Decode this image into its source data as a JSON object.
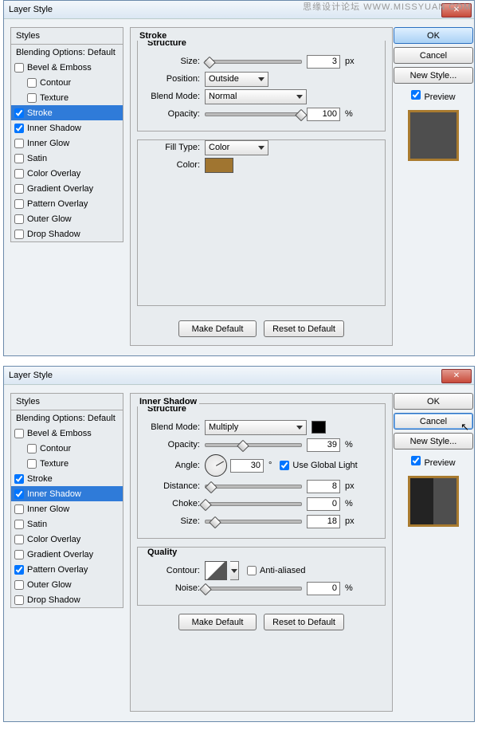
{
  "watermark": "思缘设计论坛 WWW.MISSYUAN.COM",
  "dialogs": [
    {
      "title": "Layer Style",
      "panel_name": "Stroke",
      "selected_row": "Stroke",
      "styles_header": "Styles",
      "blending_row": "Blending Options: Default",
      "styles": {
        "bevel": {
          "label": "Bevel & Emboss",
          "checked": false
        },
        "contour": {
          "label": "Contour",
          "checked": false
        },
        "texture": {
          "label": "Texture",
          "checked": false
        },
        "stroke": {
          "label": "Stroke",
          "checked": true
        },
        "inner_shadow": {
          "label": "Inner Shadow",
          "checked": true
        },
        "inner_glow": {
          "label": "Inner Glow",
          "checked": false
        },
        "satin": {
          "label": "Satin",
          "checked": false
        },
        "color_overlay": {
          "label": "Color Overlay",
          "checked": false
        },
        "gradient_overlay": {
          "label": "Gradient Overlay",
          "checked": false
        },
        "pattern_overlay": {
          "label": "Pattern Overlay",
          "checked": false
        },
        "outer_glow": {
          "label": "Outer Glow",
          "checked": false
        },
        "drop_shadow": {
          "label": "Drop Shadow",
          "checked": false
        }
      },
      "structure_label": "Structure",
      "stroke": {
        "size_label": "Size:",
        "size": "3",
        "size_unit": "px",
        "size_pos": "4%",
        "position_label": "Position:",
        "position": "Outside",
        "blend_label": "Blend Mode:",
        "blend": "Normal",
        "opacity_label": "Opacity:",
        "opacity": "100",
        "opacity_unit": "%",
        "opacity_pos": "100%",
        "filltype_label": "Fill Type:",
        "filltype": "Color",
        "color_label": "Color:",
        "color": "#a07530"
      },
      "defaults": {
        "make": "Make Default",
        "reset": "Reset to Default"
      },
      "buttons": {
        "ok": "OK",
        "cancel": "Cancel",
        "new_style": "New Style..."
      },
      "preview": {
        "label": "Preview",
        "checked": true,
        "border": "#a97b2f",
        "fill": "#4e4e4e"
      }
    },
    {
      "title": "Layer Style",
      "panel_name": "Inner Shadow",
      "selected_row": "Inner Shadow",
      "styles_header": "Styles",
      "blending_row": "Blending Options: Default",
      "styles": {
        "bevel": {
          "label": "Bevel & Emboss",
          "checked": false
        },
        "contour": {
          "label": "Contour",
          "checked": false
        },
        "texture": {
          "label": "Texture",
          "checked": false
        },
        "stroke": {
          "label": "Stroke",
          "checked": true
        },
        "inner_shadow": {
          "label": "Inner Shadow",
          "checked": true
        },
        "inner_glow": {
          "label": "Inner Glow",
          "checked": false
        },
        "satin": {
          "label": "Satin",
          "checked": false
        },
        "color_overlay": {
          "label": "Color Overlay",
          "checked": false
        },
        "gradient_overlay": {
          "label": "Gradient Overlay",
          "checked": false
        },
        "pattern_overlay": {
          "label": "Pattern Overlay",
          "checked": true
        },
        "outer_glow": {
          "label": "Outer Glow",
          "checked": false
        },
        "drop_shadow": {
          "label": "Drop Shadow",
          "checked": false
        }
      },
      "structure_label": "Structure",
      "inner_shadow": {
        "blend_label": "Blend Mode:",
        "blend": "Multiply",
        "blend_color": "#000000",
        "opacity_label": "Opacity:",
        "opacity": "39",
        "opacity_unit": "%",
        "opacity_pos": "39%",
        "angle_label": "Angle:",
        "angle": "30",
        "angle_unit": "°",
        "global_light_label": "Use Global Light",
        "global_light": true,
        "distance_label": "Distance:",
        "distance": "8",
        "distance_unit": "px",
        "distance_pos": "6%",
        "choke_label": "Choke:",
        "choke": "0",
        "choke_unit": "%",
        "choke_pos": "0%",
        "size_label": "Size:",
        "size": "18",
        "size_unit": "px",
        "size_pos": "10%"
      },
      "quality_label": "Quality",
      "quality": {
        "contour_label": "Contour:",
        "anti_label": "Anti-aliased",
        "anti": false,
        "noise_label": "Noise:",
        "noise": "0",
        "noise_unit": "%",
        "noise_pos": "0%"
      },
      "defaults": {
        "make": "Make Default",
        "reset": "Reset to Default"
      },
      "buttons": {
        "ok": "OK",
        "cancel": "Cancel",
        "new_style": "New Style..."
      },
      "preview": {
        "label": "Preview",
        "checked": true,
        "border": "#a97b2f"
      }
    }
  ]
}
